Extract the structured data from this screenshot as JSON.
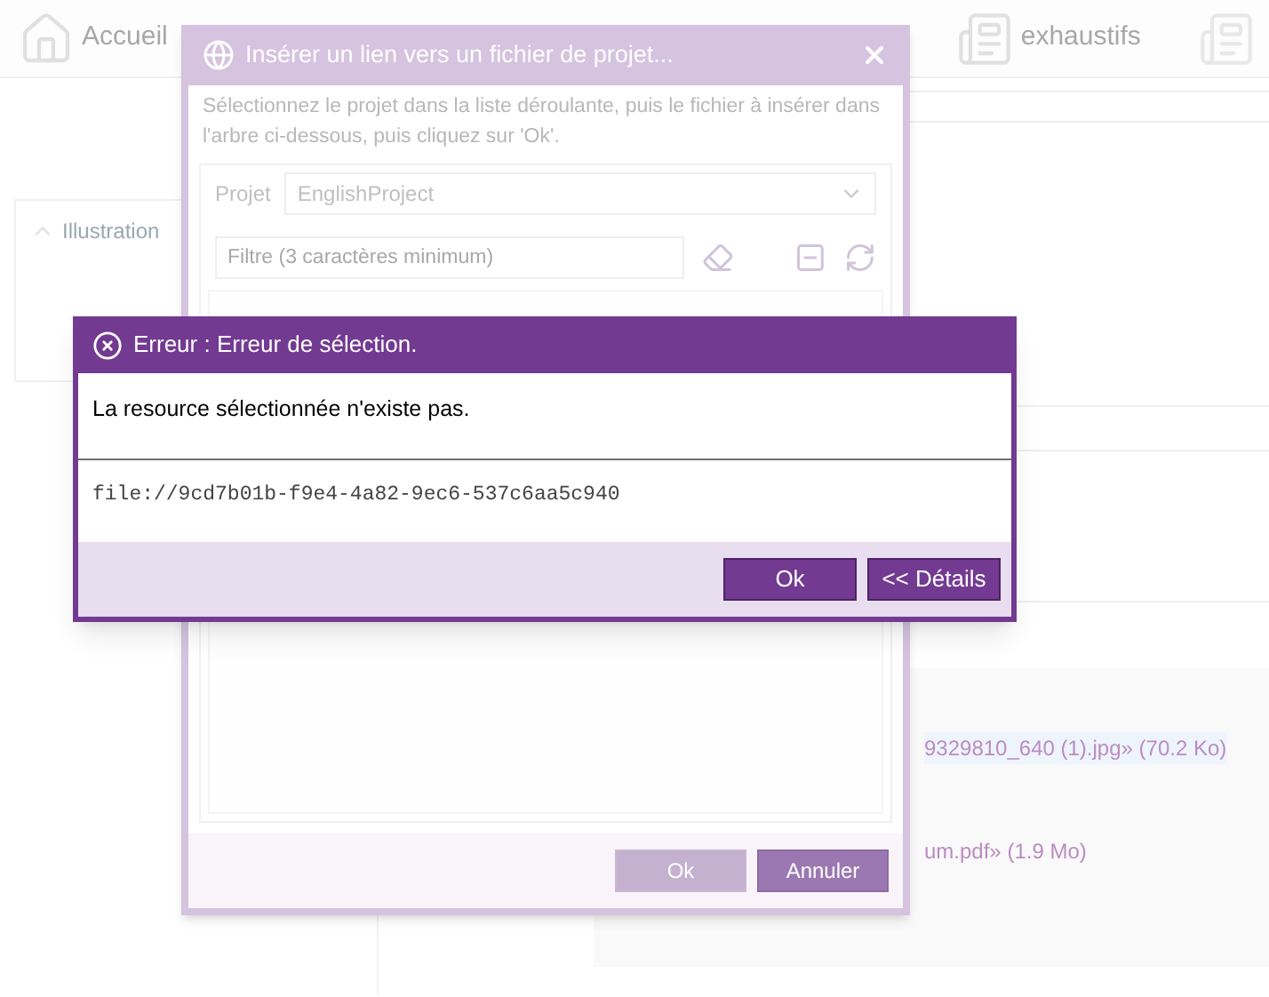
{
  "toolbar": [
    {
      "label": "Accueil"
    },
    {
      "label": "exhaustifs"
    }
  ],
  "background": {
    "panel_title": "Illustration",
    "attachments": [
      "9329810_640 (1).jpg» (70.2 Ko)",
      "um.pdf» (1.9 Mo)"
    ]
  },
  "insert_dialog": {
    "title": "Insérer un lien vers un fichier de projet...",
    "instructions": "Sélectionnez le projet dans la liste déroulante, puis le fichier à insérer dans l'arbre ci-dessous, puis cliquez sur 'Ok'.",
    "project_label": "Projet",
    "project_value": "EnglishProject",
    "filter_placeholder": "Filtre (3 caractères minimum)",
    "buttons": [
      {
        "label": "Ok",
        "disabled": true
      },
      {
        "label": "Annuler",
        "disabled": false
      }
    ]
  },
  "error_dialog": {
    "title": "Erreur : Erreur de sélection.",
    "message": "La resource sélectionnée n'existe pas.",
    "details": "file://9cd7b01b-f9e4-4a82-9ec6-537c6aa5c940",
    "buttons": [
      {
        "label": "Ok"
      },
      {
        "label": "<< Détails"
      }
    ]
  }
}
